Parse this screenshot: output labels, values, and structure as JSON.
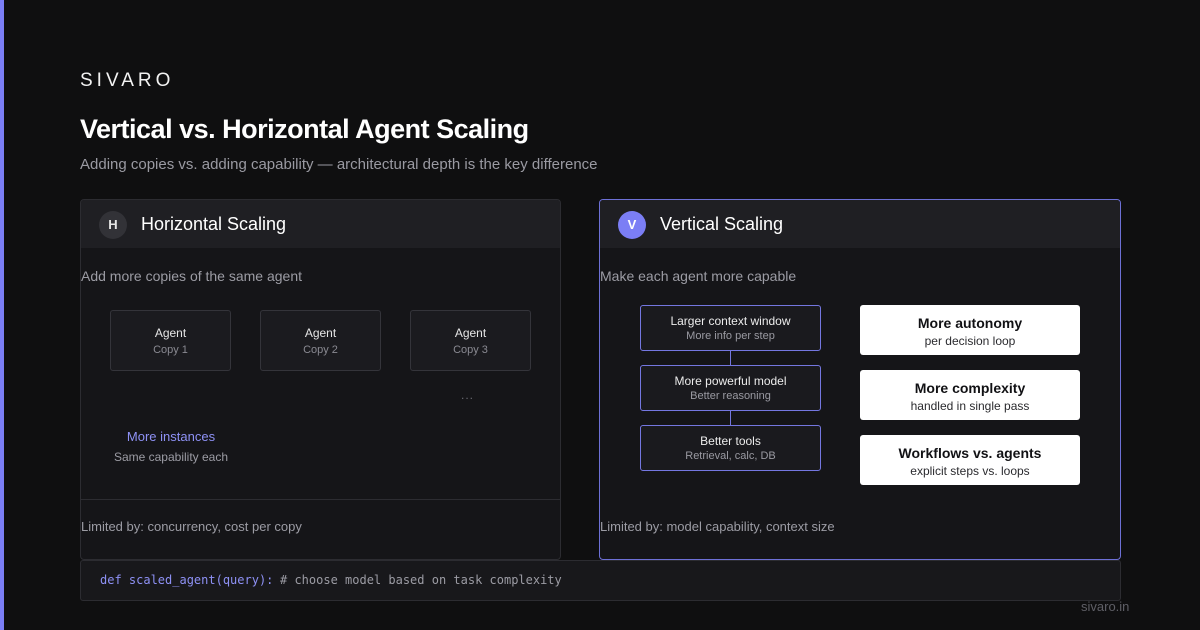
{
  "brand": "SIVARO",
  "title": "Vertical vs. Horizontal Agent Scaling",
  "subtitle": "Adding copies vs. adding capability — architectural depth is the key difference",
  "horizontal": {
    "badge": "H",
    "title": "Horizontal Scaling",
    "description": "Add more copies of the same agent",
    "copies": [
      {
        "label": "Agent",
        "sub": "Copy 1"
      },
      {
        "label": "Agent",
        "sub": "Copy 2"
      },
      {
        "label": "Agent",
        "sub": "Copy 3"
      }
    ],
    "ellipsis": "...",
    "more_label": "More instances",
    "more_sub": "Same capability each",
    "limit": "Limited by: concurrency, cost per copy"
  },
  "vertical": {
    "badge": "V",
    "title": "Vertical Scaling",
    "description": "Make each agent more capable",
    "stack": [
      {
        "label": "Larger context window",
        "sub": "More info per step"
      },
      {
        "label": "More powerful model",
        "sub": "Better reasoning"
      },
      {
        "label": "Better tools",
        "sub": "Retrieval, calc, DB"
      }
    ],
    "benefits": [
      {
        "label": "More autonomy",
        "sub": "per decision loop"
      },
      {
        "label": "More complexity",
        "sub": "handled in single pass"
      },
      {
        "label": "Workflows vs. agents",
        "sub": "explicit steps vs. loops"
      }
    ],
    "limit": "Limited by: model capability, context size"
  },
  "code": {
    "def": "def scaled_agent(query):",
    "comment": "# choose model based on task complexity"
  },
  "footer": "sivaro.in",
  "colors": {
    "accent": "#7b7ef5",
    "background": "#0f0f10",
    "panel": "#151518"
  }
}
